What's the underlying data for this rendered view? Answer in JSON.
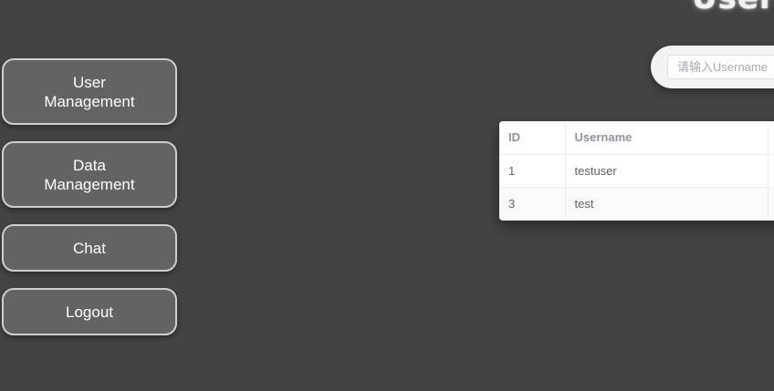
{
  "header": {
    "title": "User"
  },
  "sidebar": {
    "items": [
      {
        "label": "User\nManagement"
      },
      {
        "label": "Data\nManagement"
      },
      {
        "label": "Chat"
      },
      {
        "label": "Logout"
      }
    ]
  },
  "search": {
    "placeholder": "请输入Username",
    "value": ""
  },
  "table": {
    "columns": [
      "ID",
      "Username",
      ""
    ],
    "rows": [
      {
        "id": "1",
        "username": "testuser",
        "extra": ""
      },
      {
        "id": "3",
        "username": "test",
        "extra": ""
      }
    ]
  },
  "colors": {
    "background": "#434343",
    "button_bg": "#636363",
    "button_border": "#cfcfcf"
  }
}
